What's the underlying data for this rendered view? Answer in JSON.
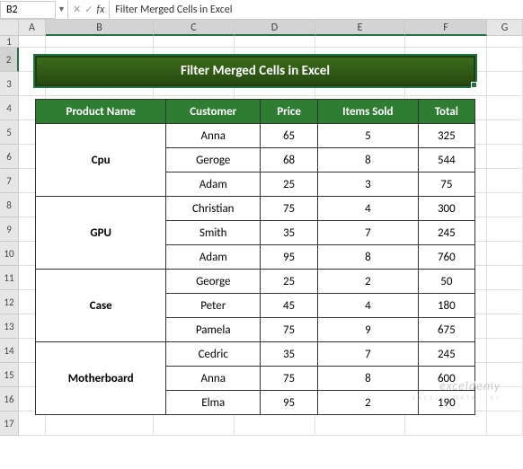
{
  "name_box": "B2",
  "formula": "Filter Merged Cells in Excel",
  "columns": [
    {
      "label": "A",
      "w": 30,
      "sel": false
    },
    {
      "label": "B",
      "w": 120,
      "sel": true
    },
    {
      "label": "C",
      "w": 90,
      "sel": true
    },
    {
      "label": "D",
      "w": 90,
      "sel": true
    },
    {
      "label": "E",
      "w": 100,
      "sel": true
    },
    {
      "label": "F",
      "w": 91,
      "sel": true
    },
    {
      "label": "G",
      "w": 40,
      "sel": false
    }
  ],
  "rows": [
    {
      "n": 1,
      "sel": false,
      "cls": "r1"
    },
    {
      "n": 2,
      "sel": true
    },
    {
      "n": 3,
      "sel": false
    },
    {
      "n": 4,
      "sel": false
    },
    {
      "n": 5,
      "sel": false
    },
    {
      "n": 6,
      "sel": false
    },
    {
      "n": 7,
      "sel": false
    },
    {
      "n": 8,
      "sel": false
    },
    {
      "n": 9,
      "sel": false
    },
    {
      "n": 10,
      "sel": false
    },
    {
      "n": 11,
      "sel": false
    },
    {
      "n": 12,
      "sel": false
    },
    {
      "n": 13,
      "sel": false
    },
    {
      "n": 14,
      "sel": false
    },
    {
      "n": 15,
      "sel": false
    },
    {
      "n": 16,
      "sel": false
    },
    {
      "n": 17,
      "sel": false
    }
  ],
  "title": "Filter Merged Cells in Excel",
  "headers": [
    "Product Name",
    "Customer",
    "Price",
    "Items Sold",
    "Total"
  ],
  "data": [
    {
      "product": "Cpu",
      "rows": [
        {
          "customer": "Anna",
          "price": 65,
          "items": 5,
          "total": 325
        },
        {
          "customer": "Geroge",
          "price": 68,
          "items": 8,
          "total": 544
        },
        {
          "customer": "Adam",
          "price": 25,
          "items": 3,
          "total": 75
        }
      ]
    },
    {
      "product": "GPU",
      "rows": [
        {
          "customer": "Christian",
          "price": 75,
          "items": 4,
          "total": 300
        },
        {
          "customer": "Smith",
          "price": 35,
          "items": 7,
          "total": 245
        },
        {
          "customer": "Adam",
          "price": 95,
          "items": 8,
          "total": 760
        }
      ]
    },
    {
      "product": "Case",
      "rows": [
        {
          "customer": "George",
          "price": 25,
          "items": 2,
          "total": 50
        },
        {
          "customer": "Peter",
          "price": 45,
          "items": 4,
          "total": 180
        },
        {
          "customer": "Pamela",
          "price": 75,
          "items": 9,
          "total": 675
        }
      ]
    },
    {
      "product": "Motherboard",
      "rows": [
        {
          "customer": "Cedric",
          "price": 35,
          "items": 7,
          "total": 245
        },
        {
          "customer": "Anna",
          "price": 75,
          "items": 8,
          "total": 600
        },
        {
          "customer": "Elma",
          "price": 95,
          "items": 2,
          "total": 190
        }
      ]
    }
  ],
  "watermark": {
    "main": "exceldemy",
    "sub": "EXCEL · DATA · BI"
  }
}
